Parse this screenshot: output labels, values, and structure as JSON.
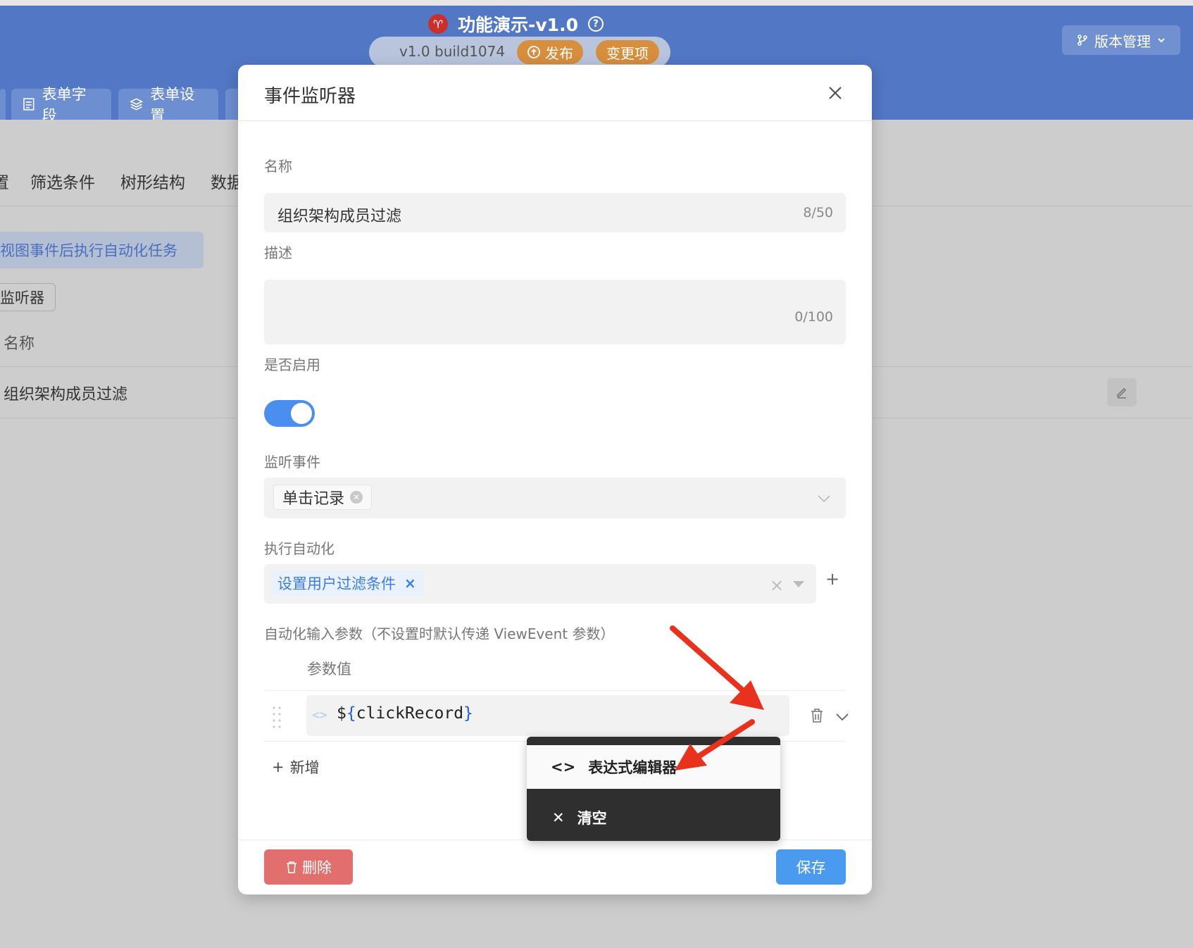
{
  "header": {
    "app_title": "功能演示-v1.0",
    "app_logo_glyph": "♈",
    "help_glyph": "?",
    "version_text": "v1.0 build1074",
    "publish_label": "发布",
    "changes_label": "变更项",
    "version_mgmt_label": "版本管理",
    "form_tabs": [
      {
        "label": "表单字段",
        "icon": "form-icon"
      },
      {
        "label": "表单设置",
        "icon": "layers-icon"
      }
    ]
  },
  "background": {
    "sub_tabs": [
      "筛选条件",
      "树形结构",
      "数据"
    ],
    "sub_tab_partial": "置",
    "info_text": "视图事件后执行自动化任务",
    "listener_btn": "监听器",
    "col_name": "名称",
    "row_name": "组织架构成员过滤"
  },
  "modal": {
    "title": "事件监听器",
    "name_label": "名称",
    "name_value": "组织架构成员过滤",
    "name_counter": "8/50",
    "desc_label": "描述",
    "desc_counter": "0/100",
    "enable_label": "是否启用",
    "enabled": true,
    "event_label": "监听事件",
    "event_tag": "单击记录",
    "automation_label": "执行自动化",
    "automation_tag": "设置用户过滤条件",
    "params_label": "自动化输入参数（不设置时默认传递 ViewEvent 参数）",
    "param_col_header": "参数值",
    "param_prefix": "$",
    "param_open": "{",
    "param_name": "clickRecord",
    "param_close": "}",
    "expr_icon": "<>",
    "add_label": "新增",
    "delete_label": "删除",
    "save_label": "保存"
  },
  "dropdown": {
    "items": [
      {
        "glyph": "<>",
        "label": "表达式编辑器",
        "icon": "code-icon"
      },
      {
        "glyph": "✕",
        "label": "清空",
        "icon": "close-icon"
      }
    ]
  },
  "colors": {
    "header_blue": "#5277c5",
    "accent_blue": "#4a9af0",
    "danger_red": "#e26e6e",
    "publish_orange": "#d88f3d",
    "arrow_red": "#e8321e"
  }
}
